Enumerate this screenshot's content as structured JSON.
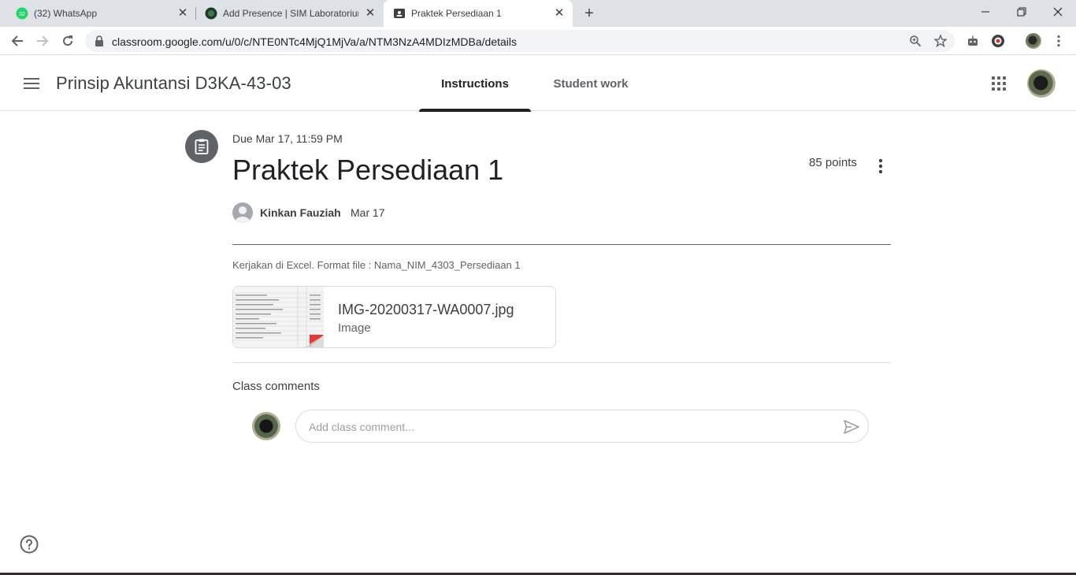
{
  "browser": {
    "tabs": [
      {
        "title": "(32) WhatsApp",
        "badge": "32",
        "active": false
      },
      {
        "title": "Add Presence | SIM Laboratorium",
        "active": false
      },
      {
        "title": "Praktek Persediaan 1",
        "active": true
      }
    ],
    "url": "classroom.google.com/u/0/c/NTE0NTc4MjQ1MjVa/a/NTM3NzA4MDIzMDBa/details"
  },
  "header": {
    "course_title": "Prinsip Akuntansi D3KA-43-03",
    "tabs": [
      {
        "label": "Instructions",
        "active": true
      },
      {
        "label": "Student work",
        "active": false
      }
    ]
  },
  "assignment": {
    "due": "Due Mar 17, 11:59 PM",
    "title": "Praktek Persediaan 1",
    "points": "85 points",
    "author": "Kinkan Fauziah",
    "posted_date": "Mar 17",
    "description": "Kerjakan di Excel. Format file : Nama_NIM_4303_Persediaan 1",
    "attachment": {
      "name": "IMG-20200317-WA0007.jpg",
      "type": "Image"
    }
  },
  "comments": {
    "label": "Class comments",
    "placeholder": "Add class comment..."
  },
  "colors": {
    "accent": "#202124",
    "muted": "#5f6368",
    "border": "#dadce0"
  }
}
